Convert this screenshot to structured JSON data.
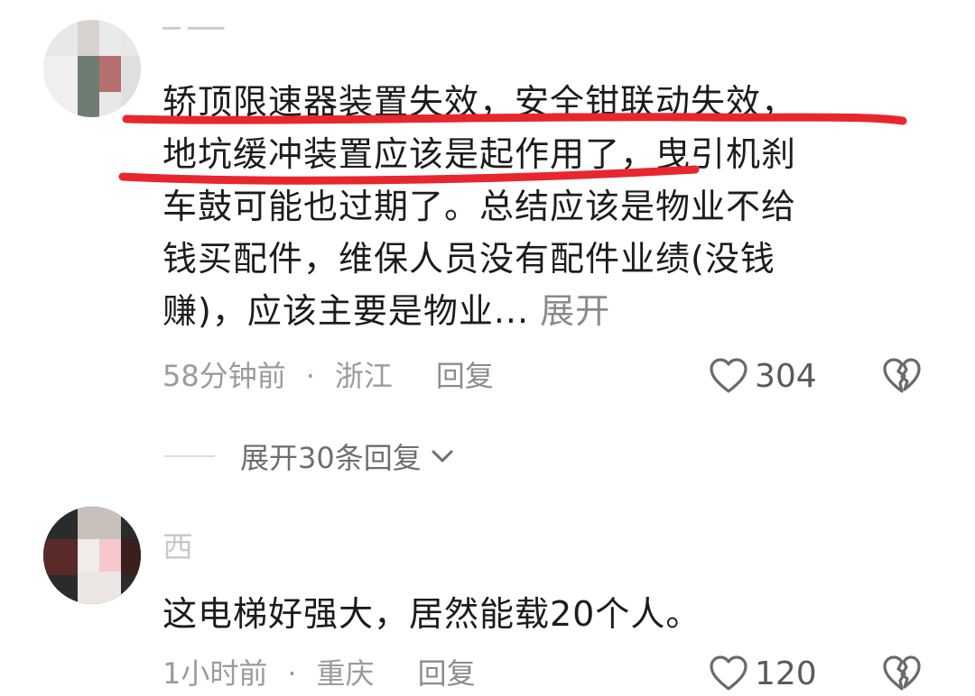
{
  "comments": [
    {
      "username": "▔ ▔▔",
      "text": "轿顶限速器装置失效，安全钳联动失效，地坑缓冲装置应该是起作用了，曳引机刹车鼓可能也过期了。总结应该是物业不给钱买配件，维保人员没有配件业绩(没钱赚)，应该主要是物业...",
      "lines": [
        "轿顶限速器装置失效，安全钳联动失效，",
        "地坑缓冲装置应该是起作用了，曳引机刹",
        "车鼓可能也过期了。总结应该是物业不给",
        "钱买配件，维保人员没有配件业绩(没钱",
        "赚)，应该主要是物业..."
      ],
      "expand_label": "展开",
      "time": "58分钟前",
      "location": "浙江",
      "reply_label": "回复",
      "likes": "304"
    },
    {
      "username": "西",
      "text": "这电梯好强大，居然能载20个人。",
      "time": "1小时前",
      "location": "重庆",
      "reply_label": "回复",
      "likes": "120"
    }
  ],
  "replies_toggle_label": "展开30条回复",
  "separator_dot": "·",
  "icons": {
    "like": "heart-outline-icon",
    "dislike": "broken-heart-icon",
    "expand": "chevron-down-icon"
  },
  "colors": {
    "highlight_underline": "#e8262e",
    "meta_gray": "#9b9b9b"
  }
}
